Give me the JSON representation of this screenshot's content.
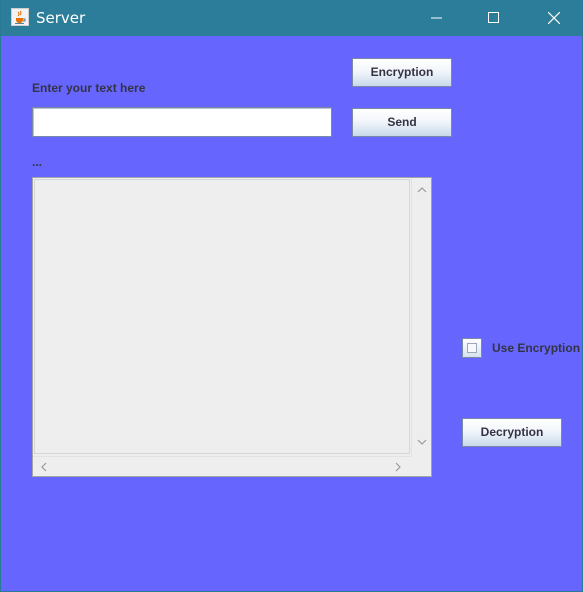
{
  "window": {
    "title": "Server"
  },
  "form": {
    "prompt_label": "Enter your text here",
    "input_value": "",
    "status_label": "...",
    "encryption_button": "Encryption",
    "send_button": "Send",
    "use_encryption_label": "Use Encryption",
    "use_encryption_checked": false,
    "decryption_button": "Decryption"
  },
  "colors": {
    "background": "#6666ff",
    "titlebar": "#2c7d99"
  },
  "icons": {
    "app": "java-cup-icon",
    "minimize": "minimize-icon",
    "maximize": "maximize-icon",
    "close": "close-icon",
    "scroll_up": "chevron-up-icon",
    "scroll_down": "chevron-down-icon",
    "scroll_left": "chevron-left-icon",
    "scroll_right": "chevron-right-icon"
  }
}
